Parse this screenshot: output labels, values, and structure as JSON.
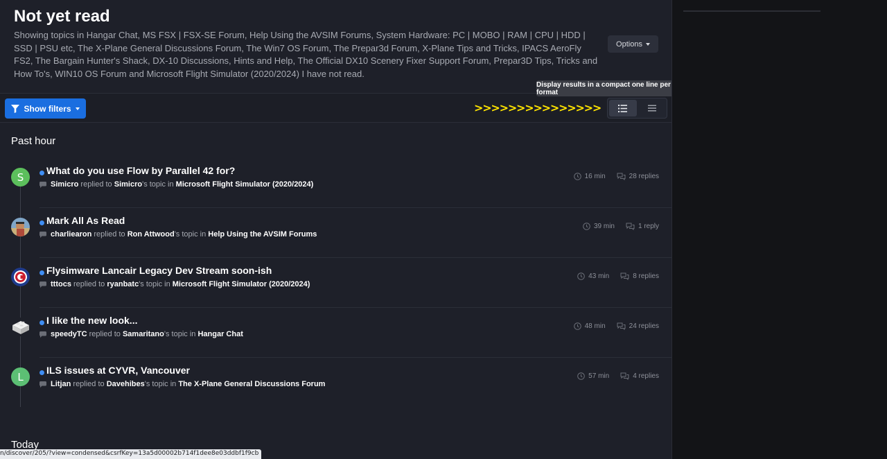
{
  "page": {
    "title": "Not yet read",
    "description": "Showing topics in Hangar Chat, MS FSX | FSX-SE Forum, Help Using the AVSIM Forums, System Hardware: PC | MOBO | RAM | CPU | HDD | SSD | PSU etc, The X-Plane General Discussions Forum, The Win7 OS Forum, The Prepar3d Forum, X-Plane Tips and Tricks, IPACS AeroFly FS2, The Bargain Hunter's Shack, DX-10 Discussions, Hints and Help, The Official DX10 Scenery Fixer Support Forum, Prepar3D Tips, Tricks and How To's, WIN10 OS Forum and Microsoft Flight Simulator (2020/2024) I have not read.",
    "options_label": "Options"
  },
  "tooltip": "Display results in a compact one line per entry format",
  "filters": {
    "show_filters_label": "Show filters",
    "annotation_arrows": ">>>>>>>>>>>>>>>"
  },
  "view_toggle": {
    "active": "expanded",
    "icons": [
      "list-expanded-icon",
      "list-condensed-icon"
    ]
  },
  "sections": {
    "past_hour": "Past hour",
    "today": "Today"
  },
  "colors": {
    "accent": "#1a6ee0",
    "unread": "#3f8ef4",
    "annotation": "#ffe500"
  },
  "items": [
    {
      "title": "What do you use Flow by Parallel 42 for?",
      "user": "Simicro",
      "replied_to": " replied to ",
      "owner": "Simicro",
      "topic_in": "'s topic in ",
      "forum": "Microsoft Flight Simulator (2020/2024)",
      "time": "16 min",
      "replies": "28 replies",
      "avatar_letter": "S",
      "avatar_color": "#5cbf5c"
    },
    {
      "title": "Mark All As Read",
      "user": "charliearon",
      "replied_to": " replied to ",
      "owner": "Ron Attwood",
      "topic_in": "'s topic in ",
      "forum": "Help Using the AVSIM Forums",
      "time": "39 min",
      "replies": "1 reply",
      "avatar_letter": "",
      "avatar_color": "#8a7a62"
    },
    {
      "title": "Flysimware Lancair Legacy Dev Stream soon-ish",
      "user": "tttocs",
      "replied_to": " replied to ",
      "owner": "ryanbatc",
      "topic_in": "'s topic in ",
      "forum": "Microsoft Flight Simulator (2020/2024)",
      "time": "43 min",
      "replies": "8 replies",
      "avatar_letter": "",
      "avatar_color": "#1f3b8c"
    },
    {
      "title": "I like the new look...",
      "user": "speedyTC",
      "replied_to": " replied to ",
      "owner": "Samaritano",
      "topic_in": "'s topic in ",
      "forum": "Hangar Chat",
      "time": "48 min",
      "replies": "24 replies",
      "avatar_letter": "",
      "avatar_color": "#d9d9d9"
    },
    {
      "title": "ILS issues at CYVR, Vancouver",
      "user": "Litjan",
      "replied_to": " replied to ",
      "owner": "Davehibes",
      "topic_in": "'s topic in ",
      "forum": "The X-Plane General Discussions Forum",
      "time": "57 min",
      "replies": "4 replies",
      "avatar_letter": "L",
      "avatar_color": "#5cbf74"
    }
  ],
  "status_bar": "n/discover/205/?view=condensed&csrfKey=13a5d00002b714f1dee8e03ddbf1f9cb"
}
